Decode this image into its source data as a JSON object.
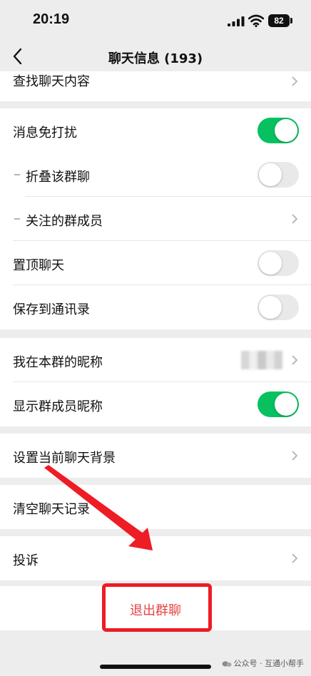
{
  "status_bar": {
    "time": "20:19",
    "battery": "82"
  },
  "nav": {
    "title": "聊天信息 (193)"
  },
  "rows": {
    "find_content": "查找聊天内容",
    "mute": "消息免打扰",
    "fold": "折叠该群聊",
    "followed": "关注的群成员",
    "pin": "置顶聊天",
    "save_contacts": "保存到通讯录",
    "nickname": "我在本群的昵称",
    "show_nicknames": "显示群成员昵称",
    "background": "设置当前聊天背景",
    "clear": "清空聊天记录",
    "report": "投诉"
  },
  "toggles": {
    "mute": true,
    "fold": false,
    "pin": false,
    "save_contacts": false,
    "show_nicknames": true
  },
  "exit": {
    "label": "退出群聊"
  },
  "watermark": {
    "text": "公众号 · 互通小帮手"
  },
  "colors": {
    "switch_on": "#07c160",
    "danger": "#e64340",
    "annotation": "#ee1c24"
  }
}
